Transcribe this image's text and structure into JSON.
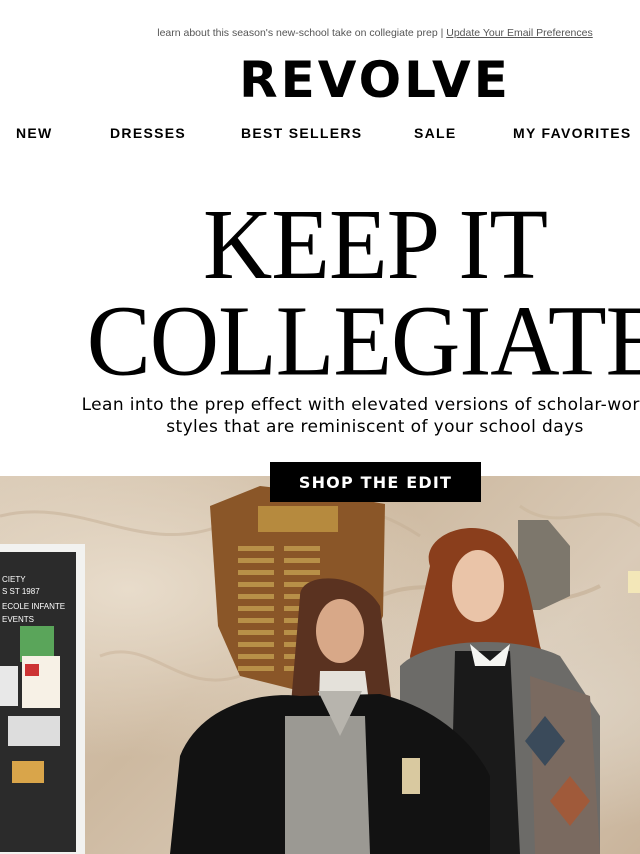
{
  "preheader": {
    "text": "learn about this season's new-school take on collegiate prep | ",
    "link": "Update Your Email Preferences"
  },
  "brand": {
    "logo": "REVOLVE"
  },
  "nav": {
    "items": [
      "NEW",
      "DRESSES",
      "BEST SELLERS",
      "SALE",
      "MY FAVORITES"
    ]
  },
  "hero": {
    "headline_line1": "KEEP IT",
    "headline_line2": "COLLEGIATE",
    "subcopy_line1": "Lean into the prep effect with elevated versions of scholar-worthy",
    "subcopy_line2": "styles that are reminiscent of your school days",
    "cta": "SHOP THE EDIT",
    "board_lines": [
      "CIETY",
      "S ST 1987",
      "ECOLE INFANTE",
      "EVENTS"
    ]
  },
  "colors": {
    "background": "#ffffff",
    "text": "#000000",
    "cta_bg": "#000000",
    "cta_text": "#ffffff"
  }
}
